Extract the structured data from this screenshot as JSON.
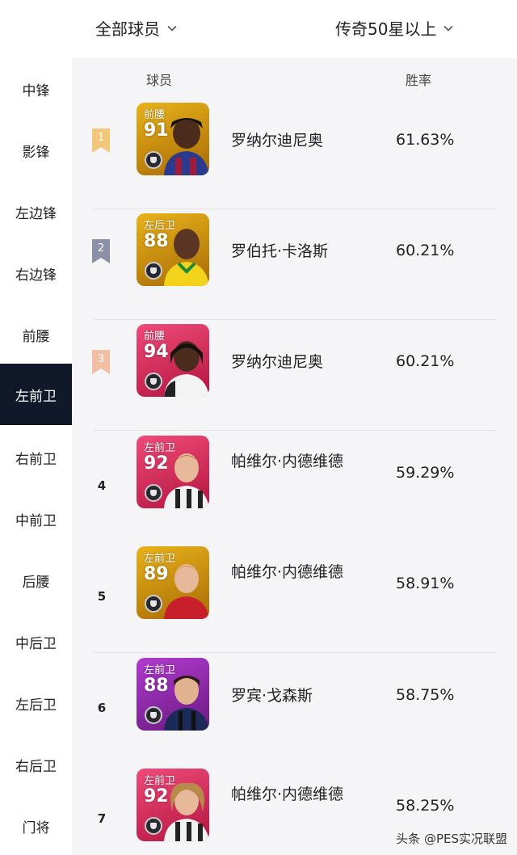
{
  "filters": {
    "category": "全部球员",
    "level": "传奇50星以上"
  },
  "sidebar": {
    "active_index": 5,
    "items": [
      "中锋",
      "影锋",
      "左边锋",
      "右边锋",
      "前腰",
      "左前卫",
      "右前卫",
      "中前卫",
      "后腰",
      "中后卫",
      "左后卫",
      "右后卫",
      "门将"
    ]
  },
  "table": {
    "header": {
      "player": "球员",
      "win_rate": "胜率"
    },
    "rows": [
      {
        "rank": "1",
        "position": "前腰",
        "rating": "91",
        "name": "罗纳尔迪尼奥",
        "win_rate": "61.63%"
      },
      {
        "rank": "2",
        "position": "左后卫",
        "rating": "88",
        "name": "罗伯托·卡洛斯",
        "win_rate": "60.21%"
      },
      {
        "rank": "3",
        "position": "前腰",
        "rating": "94",
        "name": "罗纳尔迪尼奥",
        "win_rate": "60.21%"
      },
      {
        "rank": "4",
        "position": "左前卫",
        "rating": "92",
        "name": "帕维尔·内德维德",
        "win_rate": "59.29%"
      },
      {
        "rank": "5",
        "position": "左前卫",
        "rating": "89",
        "name": "帕维尔·内德维德",
        "win_rate": "58.91%"
      },
      {
        "rank": "6",
        "position": "左前卫",
        "rating": "88",
        "name": "罗宾·戈森斯",
        "win_rate": "58.75%"
      },
      {
        "rank": "7",
        "position": "左前卫",
        "rating": "92",
        "name": "帕维尔·内德维德",
        "win_rate": "58.25%"
      }
    ]
  },
  "colors": {
    "rank_1": "#f3c77a",
    "rank_2": "#8b90a6",
    "rank_3": "#f2bfa3",
    "card_gold": "#c9920f",
    "card_pink": "#d62a5a",
    "card_purple": "#8a2aa0",
    "sidebar_active": "#11182a"
  },
  "watermark": "头条 @PES实况联盟"
}
